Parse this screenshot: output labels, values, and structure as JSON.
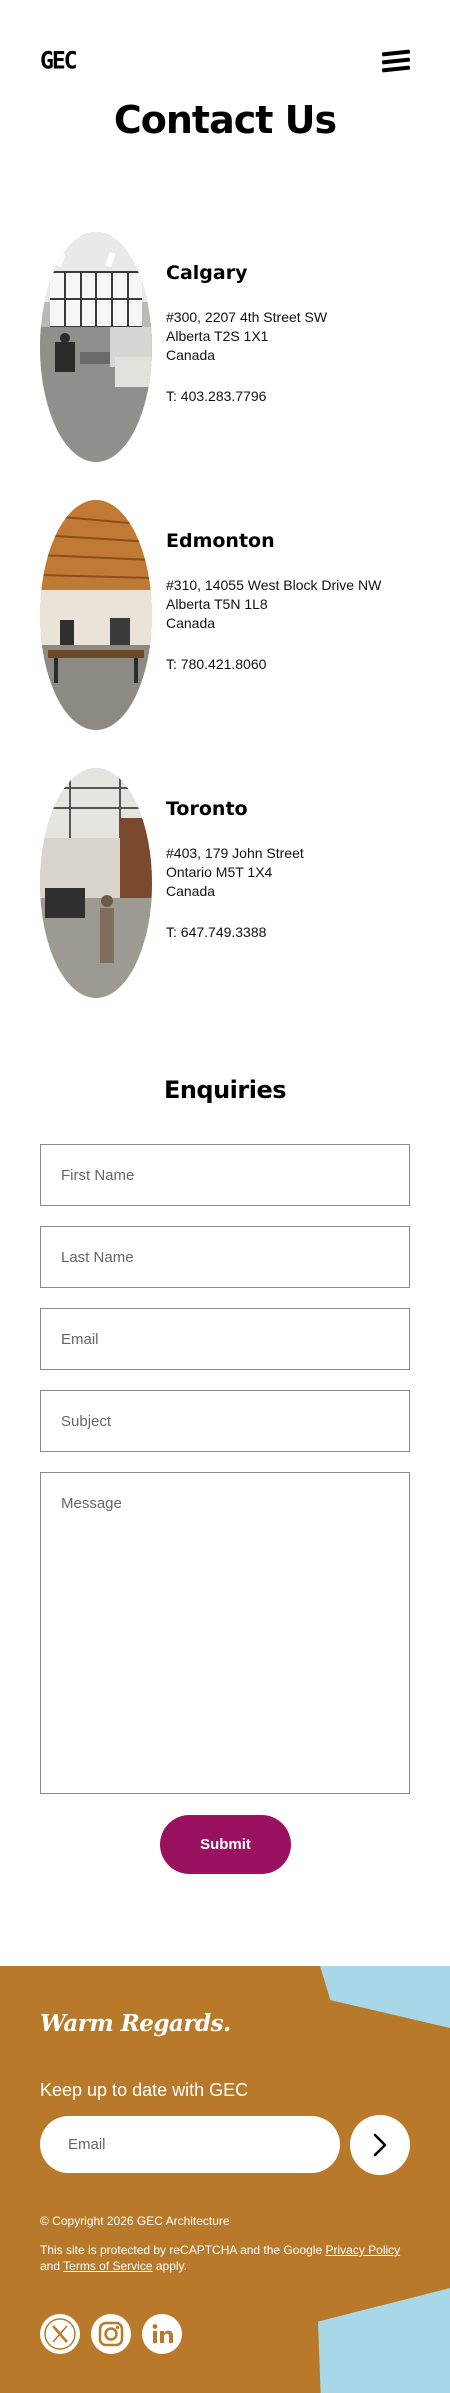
{
  "header": {
    "logo_text": "GEC",
    "menu_icon": "hamburger-menu-icon"
  },
  "page_title": "Contact Us",
  "locations": [
    {
      "name": "Calgary",
      "address_line1": "#300, 2207 4th Street SW",
      "address_line2": "Alberta T2S 1X1",
      "country": "Canada",
      "phone": "T: 403.283.7796"
    },
    {
      "name": "Edmonton",
      "address_line1": "#310, 14055 West Block Drive NW",
      "address_line2": "Alberta T5N 1L8",
      "country": "Canada",
      "phone": "T: 780.421.8060"
    },
    {
      "name": "Toronto",
      "address_line1": "#403, 179 John Street",
      "address_line2": "Ontario M5T 1X4",
      "country": "Canada",
      "phone": "T: 647.749.3388"
    }
  ],
  "enquiries": {
    "title": "Enquiries",
    "first_name_placeholder": "First Name",
    "last_name_placeholder": "Last Name",
    "email_placeholder": "Email",
    "subject_placeholder": "Subject",
    "message_placeholder": "Message",
    "submit_label": "Submit"
  },
  "footer": {
    "regards": "Warm Regards.",
    "newsletter_label": "Keep up to date with GEC",
    "email_placeholder": "Email",
    "submit_icon": "chevron-right-icon",
    "copyright": "© Copyright 2026 GEC Architecture",
    "recaptcha_prefix": "This site is protected by reCAPTCHA and the Google",
    "privacy_policy": "Privacy Policy",
    "and_text": "and",
    "terms": "Terms of Service",
    "apply_text": "apply.",
    "social_icons": [
      "x-twitter-icon",
      "instagram-icon",
      "linkedin-icon"
    ]
  },
  "colors": {
    "accent_button": "#99115f",
    "footer_bg": "#b87a2a",
    "footer_shape": "#a8d8e8"
  }
}
